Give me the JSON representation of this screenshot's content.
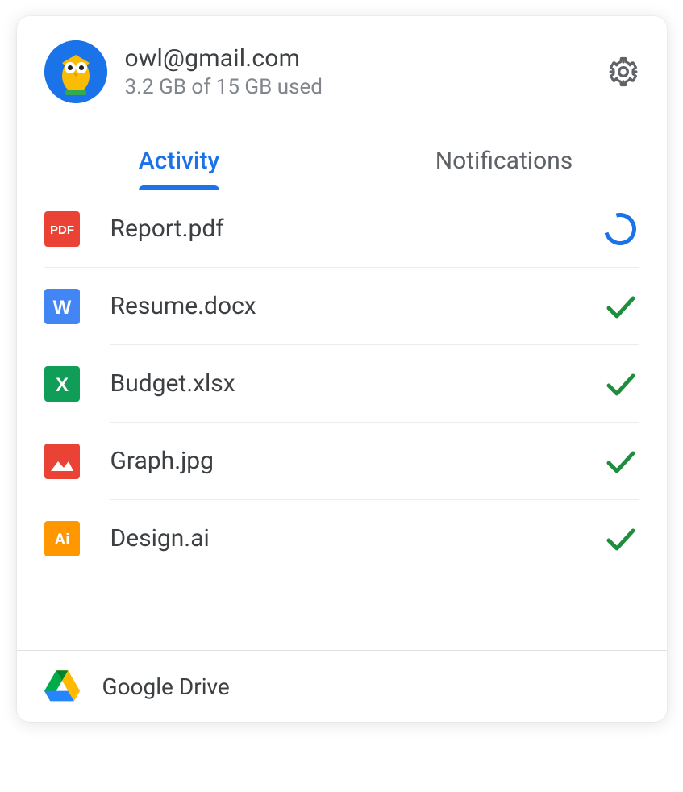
{
  "header": {
    "email": "owl@gmail.com",
    "storage": "3.2 GB of 15 GB used"
  },
  "tabs": {
    "activity": "Activity",
    "notifications": "Notifications",
    "active": "activity"
  },
  "files": [
    {
      "icon": "pdf",
      "name": "Report.pdf",
      "status": "syncing"
    },
    {
      "icon": "docx",
      "name": "Resume.docx",
      "status": "done"
    },
    {
      "icon": "xlsx",
      "name": "Budget.xlsx",
      "status": "done"
    },
    {
      "icon": "image",
      "name": "Graph.jpg",
      "status": "done"
    },
    {
      "icon": "ai",
      "name": "Design.ai",
      "status": "done"
    }
  ],
  "icon_colors": {
    "pdf": "#ea4335",
    "docx": "#4285f4",
    "xlsx": "#0f9d58",
    "image": "#ea4335",
    "ai": "#ff9800"
  },
  "footer": {
    "label": "Google Drive"
  }
}
